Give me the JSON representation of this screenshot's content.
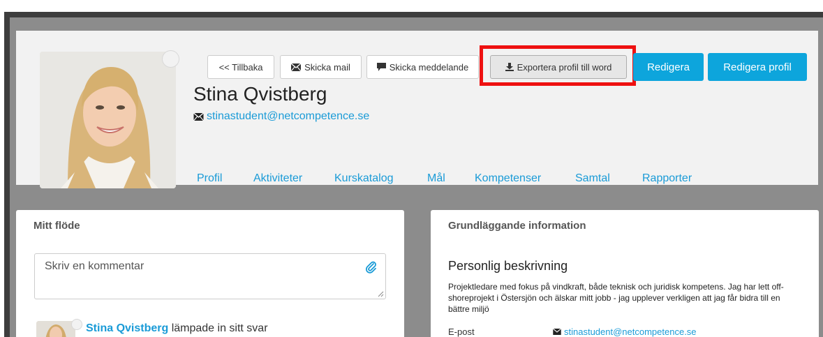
{
  "header": {
    "buttons": {
      "back": "<< Tillbaka",
      "send_mail": "Skicka mail",
      "send_message": "Skicka meddelande",
      "export_word": "Exportera profil till word",
      "edit": "Redigera",
      "edit_profile": "Redigera profil"
    },
    "name": "Stina Qvistberg",
    "email": "stinastudent@netcompetence.se"
  },
  "nav": {
    "tabs": [
      {
        "label": "Profil"
      },
      {
        "label": "Aktiviteter"
      },
      {
        "label": "Kurskatalog"
      },
      {
        "label": "Mål"
      },
      {
        "label": "Kompetenser"
      },
      {
        "label": "Samtal"
      },
      {
        "label": "Rapporter"
      }
    ]
  },
  "feed": {
    "title": "Mitt flöde",
    "comment_placeholder": "Skriv en kommentar",
    "item": {
      "author": "Stina Qvistberg",
      "action": " lämpade in sitt svar"
    }
  },
  "info": {
    "title": "Grundläggande information",
    "section_title": "Personlig beskrivning",
    "description": "Projektledare med fokus på vindkraft, både teknisk och juridisk kompetens. Jag har lett off-shoreprojekt i Östersjön och älskar mitt jobb - jag upplever verkligen att jag får bidra till en bättre miljö",
    "row_label": "E-post",
    "row_value": "stinastudent@netcompetence.se"
  },
  "colors": {
    "accent": "#0da5dc",
    "link": "#1a9bd7",
    "highlight": "#ee1111"
  }
}
